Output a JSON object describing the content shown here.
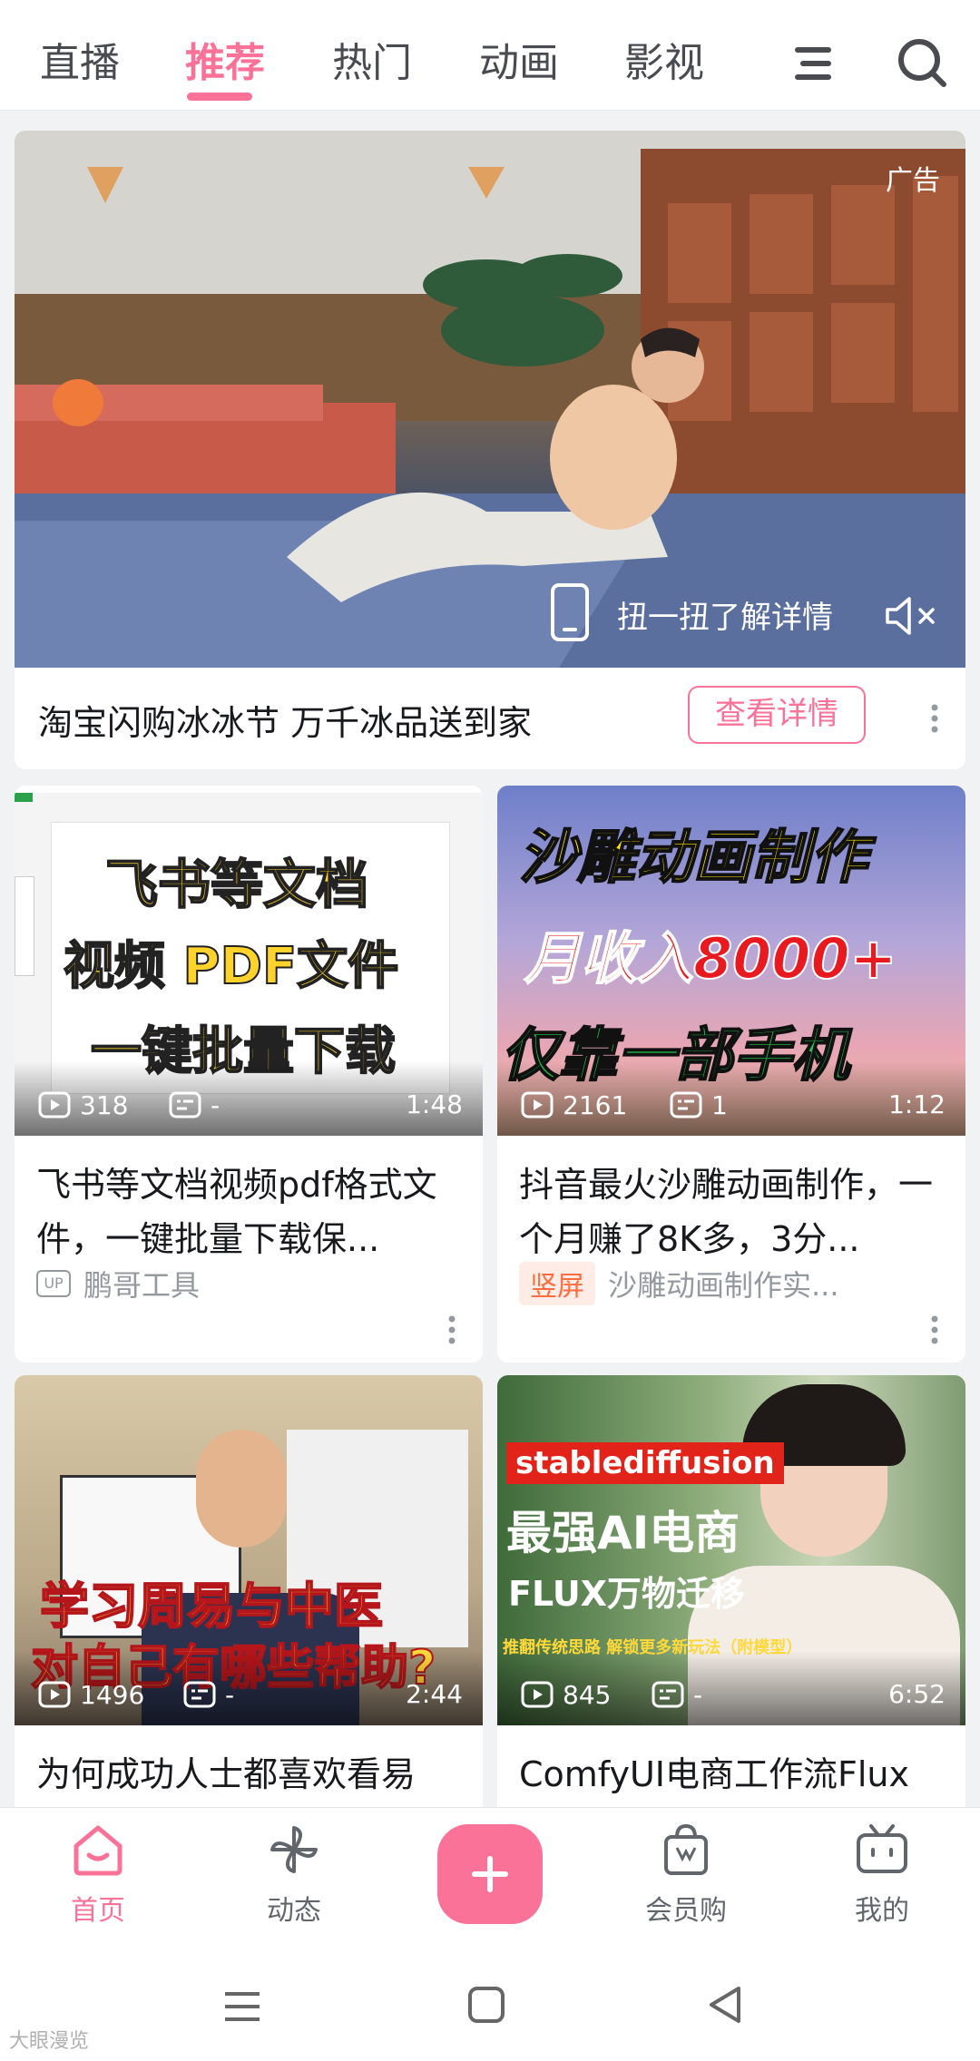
{
  "tabs": [
    {
      "label": "直播",
      "active": false
    },
    {
      "label": "推荐",
      "active": true
    },
    {
      "label": "热门",
      "active": false
    },
    {
      "label": "动画",
      "active": false
    },
    {
      "label": "影视",
      "active": false
    }
  ],
  "header_icons": [
    "menu-icon",
    "search-icon"
  ],
  "accent_color": "#fb7299",
  "ad": {
    "label": "广告",
    "shake_text": "扭一扭了解详情",
    "title": "淘宝闪购冰冰节 万千冰品送到家",
    "button": "查看详情"
  },
  "videos": [
    {
      "thumb_lines": [
        "飞书等文档",
        "视频  PDF文件",
        "一键批量下载"
      ],
      "views": "318",
      "danmaku": "-",
      "duration": "1:48",
      "title": "飞书等文档视频pdf格式文件，一键批量下载保...",
      "badge": "UP",
      "author": "鹏哥工具"
    },
    {
      "thumb_lines": [
        "沙雕动画制作",
        "月收入8000+",
        "仅靠一部手机"
      ],
      "views": "2161",
      "danmaku": "1",
      "duration": "1:12",
      "title": "抖音最火沙雕动画制作，一个月赚了8K多，3分...",
      "badge": "竖屏",
      "author": "沙雕动画制作实..."
    },
    {
      "thumb_lines": [
        "学习周易与中医",
        "对自己有哪些帮助?"
      ],
      "views": "1496",
      "danmaku": "-",
      "duration": "2:44",
      "title": "为何成功人士都喜欢看易"
    },
    {
      "thumb_lines": [
        "stablediffusion",
        "最强AI电商",
        "FLUX万物迁移",
        "推翻传统思路 解锁更多新玩法（附模型）"
      ],
      "views": "845",
      "danmaku": "-",
      "duration": "6:52",
      "title": "ComfyUI电商工作流Flux"
    }
  ],
  "bottom_nav": [
    {
      "label": "首页",
      "icon": "home-icon",
      "active": true
    },
    {
      "label": "动态",
      "icon": "pinwheel-icon",
      "active": false
    },
    {
      "label": "",
      "icon": "plus-icon",
      "active": false
    },
    {
      "label": "会员购",
      "icon": "shopping-bag-icon",
      "active": false
    },
    {
      "label": "我的",
      "icon": "tv-icon",
      "active": false
    }
  ],
  "watermark": "大眼漫览"
}
